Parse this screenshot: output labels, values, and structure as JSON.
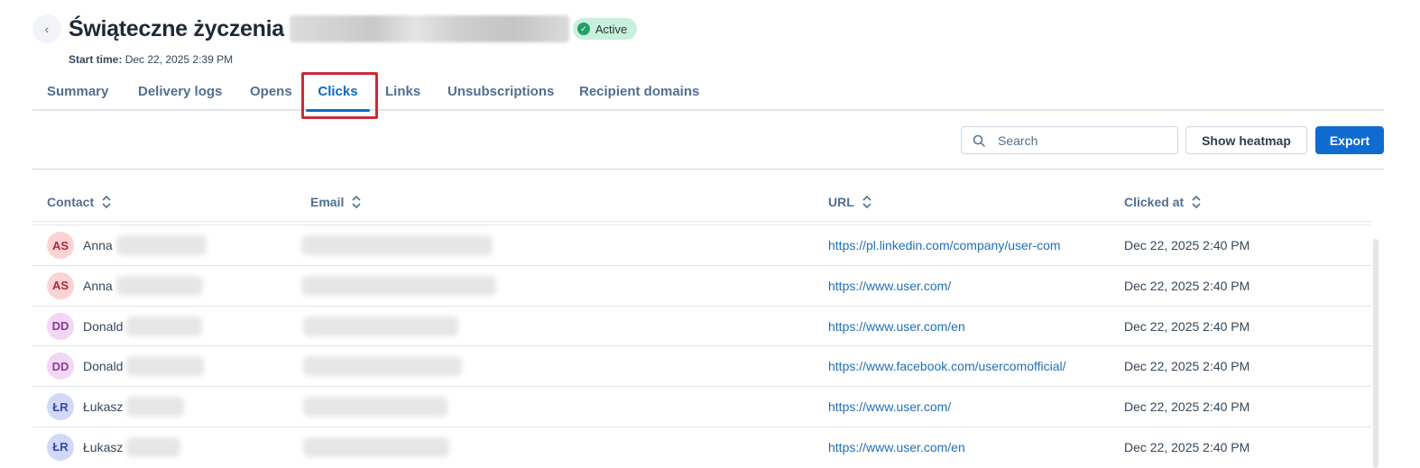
{
  "header": {
    "back_icon": "chevron-left-icon",
    "title": "Świąteczne życzenia",
    "status_badge": "Active",
    "status_color": "#22a06b",
    "start_time_label": "Start time:",
    "start_time_value": "Dec 22, 2025 2:39 PM"
  },
  "tabs": [
    {
      "label": "Summary"
    },
    {
      "label": "Delivery logs"
    },
    {
      "label": "Opens"
    },
    {
      "label": "Clicks",
      "active": true
    },
    {
      "label": "Links"
    },
    {
      "label": "Unsubscriptions"
    },
    {
      "label": "Recipient domains"
    }
  ],
  "toolbar": {
    "search_placeholder": "Search",
    "search_icon": "search-icon",
    "heatmap_label": "Show heatmap",
    "export_label": "Export",
    "accent_color": "#0f6bcf"
  },
  "table": {
    "columns": [
      "Contact",
      "Email",
      "URL",
      "Clicked at"
    ],
    "sort_icon": "sort-icon",
    "rows": [
      {
        "initials": "AS",
        "name": "Anna",
        "url": "https://pl.linkedin.com/company/user-com",
        "clicked_at": "Dec 22, 2025 2:40 PM",
        "avatar_bg": "#fbd3d3",
        "avatar_fg": "#b0283a"
      },
      {
        "initials": "AS",
        "name": "Anna",
        "url": "https://www.user.com/",
        "clicked_at": "Dec 22, 2025 2:40 PM",
        "avatar_bg": "#fbd3d3",
        "avatar_fg": "#b0283a"
      },
      {
        "initials": "DD",
        "name": "Donald",
        "url": "https://www.user.com/en",
        "clicked_at": "Dec 22, 2025 2:40 PM",
        "avatar_bg": "#f1d7f4",
        "avatar_fg": "#8e3a99"
      },
      {
        "initials": "DD",
        "name": "Donald",
        "url": "https://www.facebook.com/usercomofficial/",
        "clicked_at": "Dec 22, 2025 2:40 PM",
        "avatar_bg": "#f1d7f4",
        "avatar_fg": "#8e3a99"
      },
      {
        "initials": "ŁR",
        "name": "Łukasz",
        "url": "https://www.user.com/",
        "clicked_at": "Dec 22, 2025 2:40 PM",
        "avatar_bg": "#d1d8f8",
        "avatar_fg": "#3947a8"
      },
      {
        "initials": "ŁR",
        "name": "Łukasz",
        "url": "https://www.user.com/en",
        "clicked_at": "Dec 22, 2025 2:40 PM",
        "avatar_bg": "#d1d8f8",
        "avatar_fg": "#3947a8"
      }
    ]
  }
}
